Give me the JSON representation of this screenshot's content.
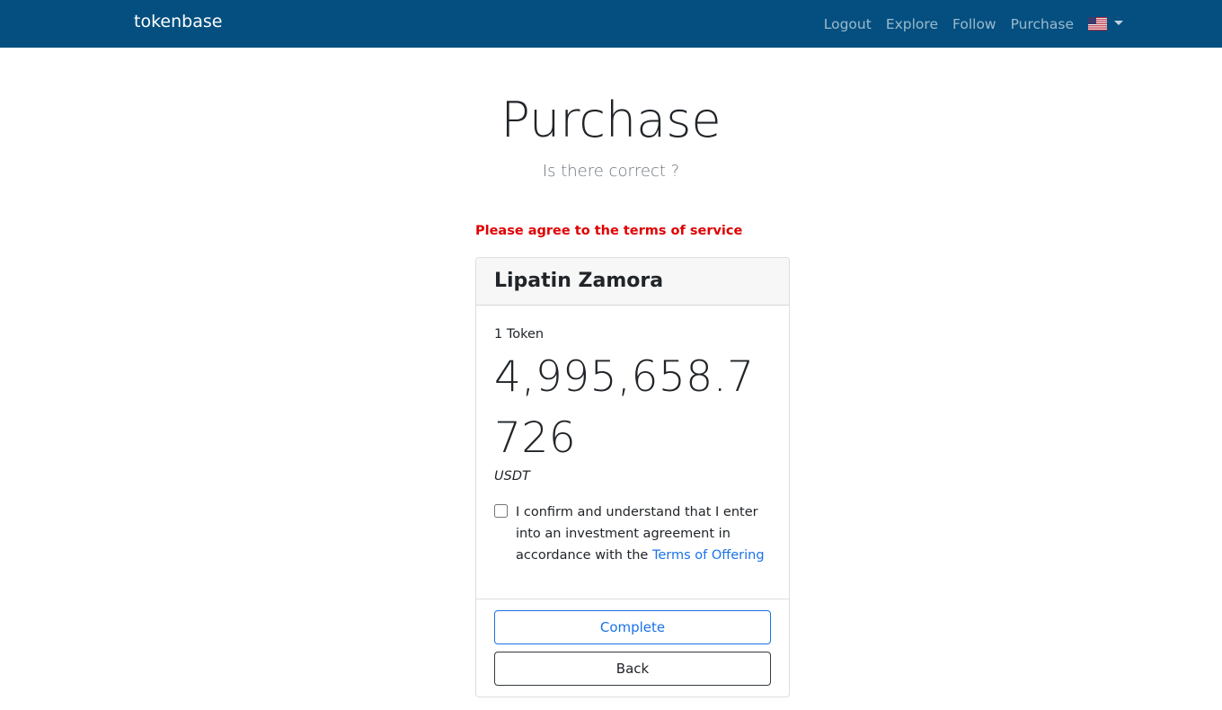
{
  "navbar": {
    "brand": "tokenbase",
    "links": [
      "Logout",
      "Explore",
      "Follow",
      "Purchase"
    ],
    "language_icon": "us-flag-icon",
    "colors": {
      "background": "#044f80"
    }
  },
  "page": {
    "title": "Purchase",
    "subtitle": "Is there correct ?"
  },
  "error_message": "Please agree to the terms of service",
  "card": {
    "header": "Lipatin Zamora",
    "quantity": "1 Token",
    "price": "4,995,658.7726",
    "currency": "USDT",
    "agreement": {
      "checked": false,
      "text": "I confirm and understand that I enter into an investment agreement in accordance with the ",
      "link": "Terms of Offering"
    },
    "buttons": {
      "complete": "Complete",
      "back": "Back"
    }
  },
  "colors": {
    "error": "#e00000",
    "link": "#1a73e8"
  }
}
